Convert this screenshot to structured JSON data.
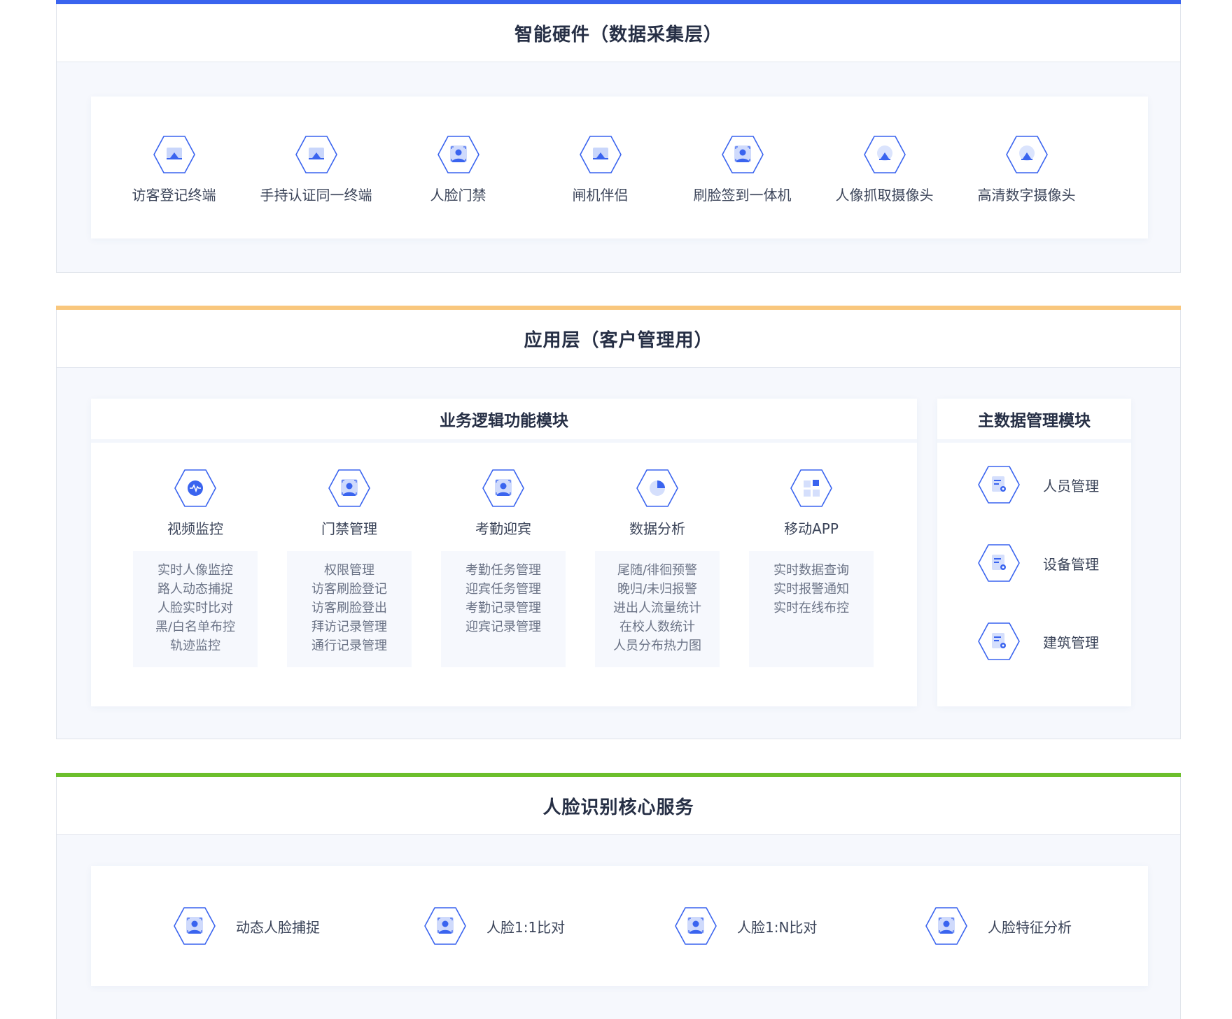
{
  "hardware": {
    "title": "智能硬件（数据采集层）",
    "items": [
      {
        "label": "访客登记终端",
        "icon": "terminal-icon"
      },
      {
        "label": "手持认证同一终端",
        "icon": "terminal-icon"
      },
      {
        "label": "人脸门禁",
        "icon": "face-scan-icon"
      },
      {
        "label": "闸机伴侣",
        "icon": "terminal-icon"
      },
      {
        "label": "刷脸签到一体机",
        "icon": "face-scan-icon"
      },
      {
        "label": "人像抓取摄像头",
        "icon": "camera-icon"
      },
      {
        "label": "高清数字摄像头",
        "icon": "camera-icon"
      }
    ]
  },
  "application": {
    "title": "应用层（客户管理用）",
    "business": {
      "title": "业务逻辑功能模块",
      "columns": [
        {
          "name": "视频监控",
          "icon": "video-monitor-icon",
          "subs": [
            "实时人像监控",
            "路人动态捕捉",
            "人脸实时比对",
            "黑/白名单布控",
            "轨迹监控"
          ]
        },
        {
          "name": "门禁管理",
          "icon": "face-scan-icon",
          "subs": [
            "权限管理",
            "访客刷脸登记",
            "访客刷脸登出",
            "拜访记录管理",
            "通行记录管理"
          ]
        },
        {
          "name": "考勤迎宾",
          "icon": "face-scan-icon",
          "subs": [
            "考勤任务管理",
            "迎宾任务管理",
            "考勤记录管理",
            "迎宾记录管理"
          ]
        },
        {
          "name": "数据分析",
          "icon": "pie-chart-icon",
          "subs": [
            "尾随/徘徊预警",
            "晚归/未归报警",
            "进出人流量统计",
            "在校人数统计",
            "人员分布热力图"
          ]
        },
        {
          "name": "移动APP",
          "icon": "app-grid-icon",
          "subs": [
            "实时数据查询",
            "实时报警通知",
            "实时在线布控"
          ]
        }
      ]
    },
    "master": {
      "title": "主数据管理模块",
      "items": [
        {
          "label": "人员管理",
          "icon": "document-gear-icon"
        },
        {
          "label": "设备管理",
          "icon": "document-gear-icon"
        },
        {
          "label": "建筑管理",
          "icon": "document-gear-icon"
        }
      ]
    }
  },
  "face_core": {
    "title": "人脸识别核心服务",
    "items": [
      {
        "label": "动态人脸捕捉",
        "icon": "face-scan-icon"
      },
      {
        "label": "人脸1:1比对",
        "icon": "face-scan-icon"
      },
      {
        "label": "人脸1:N比对",
        "icon": "face-scan-icon"
      },
      {
        "label": "人脸特征分析",
        "icon": "face-scan-icon"
      }
    ]
  },
  "colors": {
    "hardware_bar": "#3a64ef",
    "application_bar": "#f9c77d",
    "face_bar": "#6cbf2c",
    "icon_stroke": "#3a64ef"
  }
}
